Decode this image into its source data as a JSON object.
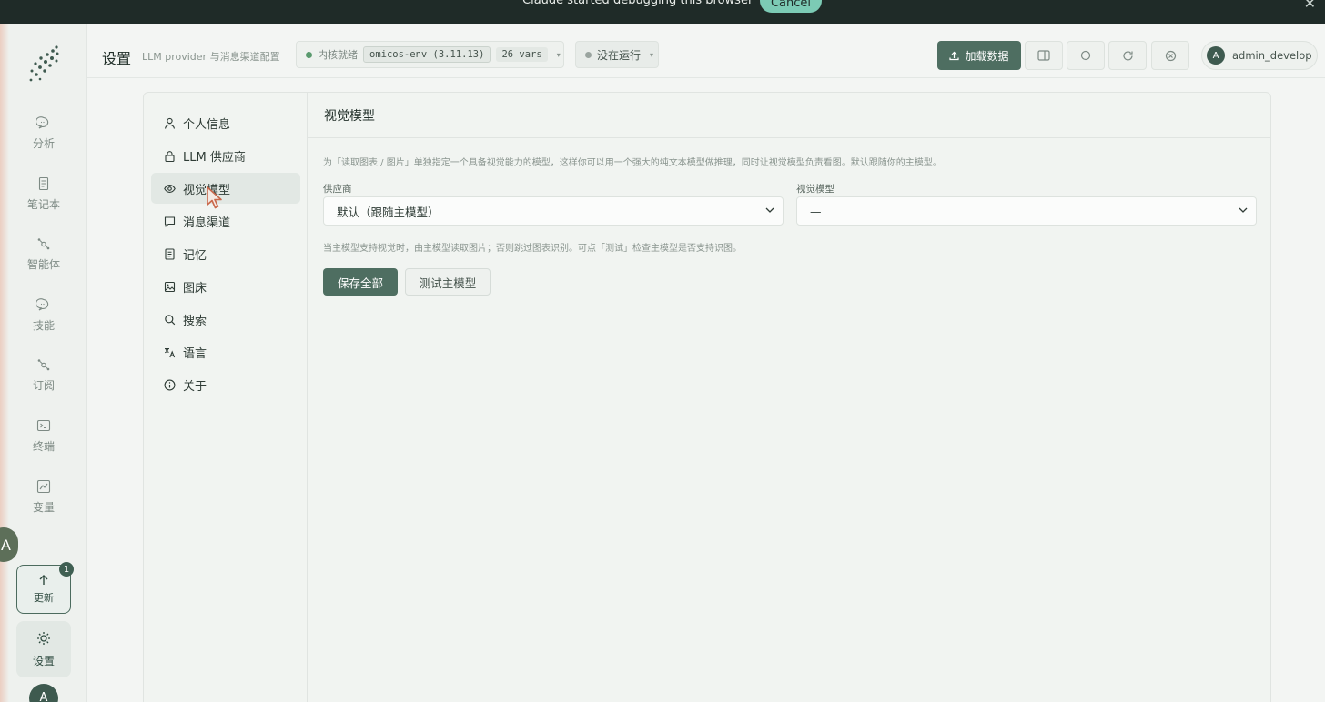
{
  "banner": {
    "message": "Claude  started debugging this browser",
    "cancel_label": "Cancel",
    "close_glyph": "✕"
  },
  "rail": {
    "items": [
      {
        "label": "分析",
        "icon": "chat-bubble-icon"
      },
      {
        "label": "笔记本",
        "icon": "notebook-icon"
      },
      {
        "label": "智能体",
        "icon": "agent-nodes-icon"
      },
      {
        "label": "技能",
        "icon": "skill-bubble-icon"
      },
      {
        "label": "订阅",
        "icon": "subscribe-nodes-icon"
      },
      {
        "label": "终端",
        "icon": "terminal-icon"
      },
      {
        "label": "变量",
        "icon": "variable-chart-icon"
      }
    ],
    "update_label": "更新",
    "update_badge": "1",
    "settings_label": "设置",
    "avatar_letter": "A",
    "translate_glyph": "A"
  },
  "header": {
    "title": "设置",
    "subtitle": "LLM provider 与消息渠道配置",
    "kernel_status": "内核就绪",
    "kernel_env": "omicos-env (3.11.13)",
    "kernel_vars": "26 vars",
    "run_status": "没在运行",
    "load_button": "加载数据",
    "user_name": "admin_develop",
    "user_initial": "A",
    "colors": {
      "ready_dot": "#5a9a6e",
      "idle_dot": "#9aa49f",
      "accent": "#4e6e61"
    }
  },
  "settings_nav": {
    "items": [
      {
        "label": "个人信息",
        "icon": "user-icon"
      },
      {
        "label": "LLM 供应商",
        "icon": "lock-icon"
      },
      {
        "label": "视觉模型",
        "icon": "eye-icon",
        "active": true
      },
      {
        "label": "消息渠道",
        "icon": "message-icon"
      },
      {
        "label": "记忆",
        "icon": "memory-icon"
      },
      {
        "label": "图床",
        "icon": "image-icon"
      },
      {
        "label": "搜索",
        "icon": "search-icon"
      },
      {
        "label": "语言",
        "icon": "translate-icon"
      },
      {
        "label": "关于",
        "icon": "info-icon"
      }
    ]
  },
  "panel": {
    "title": "视觉模型",
    "description": "为「读取图表 / 图片」单独指定一个具备视觉能力的模型，这样你可以用一个强大的纯文本模型做推理，同时让视觉模型负责看图。默认跟随你的主模型。",
    "provider_label": "供应商",
    "provider_value": "默认（跟随主模型）",
    "vision_label": "视觉模型",
    "vision_value": "—",
    "hint": "当主模型支持视觉时，由主模型读取图片；否则跳过图表识别。可点「测试」检查主模型是否支持识图。",
    "save_button": "保存全部",
    "test_button": "测试主模型"
  }
}
